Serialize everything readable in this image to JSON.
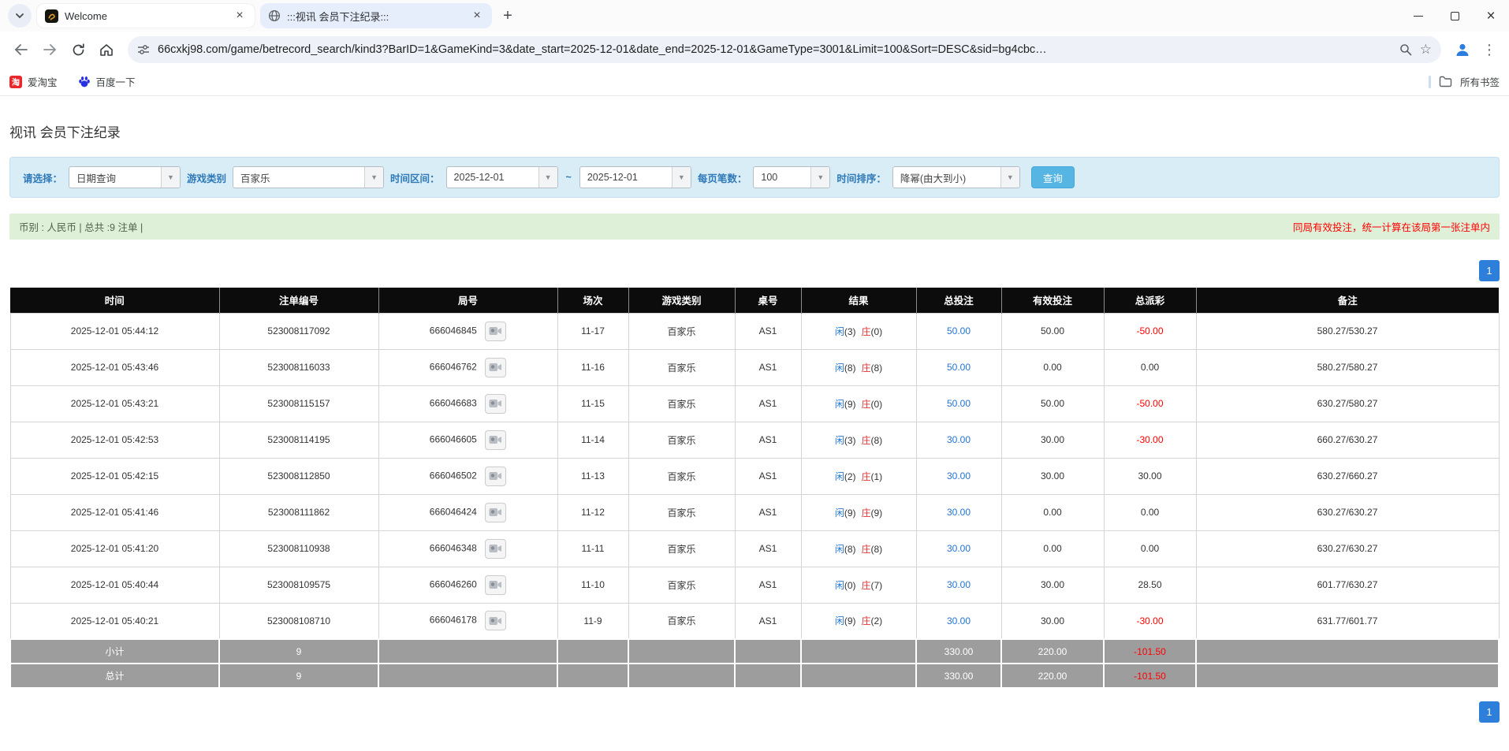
{
  "browser": {
    "tabs": [
      {
        "title": "Welcome"
      },
      {
        "title": ":::视讯 会员下注纪录:::"
      }
    ],
    "url": "66cxkj98.com/game/betrecord_search/kind3?BarID=1&GameKind=3&date_start=2025-12-01&date_end=2025-12-01&GameType=3001&Limit=100&Sort=DESC&sid=bg4cbc…",
    "bookmarks": [
      {
        "label": "爱淘宝"
      },
      {
        "label": "百度一下"
      }
    ],
    "all_bookmarks_label": "所有书签",
    "icons": [
      "chevron-down-icon",
      "dragon-favicon-icon",
      "globe-favicon-icon",
      "close-icon",
      "new-tab-icon",
      "minimize-icon",
      "maximize-icon",
      "back-icon",
      "forward-icon",
      "reload-icon",
      "home-icon",
      "tune-icon",
      "zoom-icon",
      "star-icon",
      "profile-icon",
      "kebab-menu-icon",
      "taobao-icon",
      "baidu-paw-icon",
      "folder-icon",
      "video-replay-icon"
    ]
  },
  "page": {
    "title": "视讯 会员下注纪录",
    "filters": {
      "select_label": "请选择：",
      "select_value": "日期查询",
      "game_type_label": "游戏类别",
      "game_type_value": "百家乐",
      "range_label": "时间区间：",
      "date_start": "2025-12-01",
      "range_separator": "~",
      "date_end": "2025-12-01",
      "page_size_label": "每页笔数：",
      "page_size_value": "100",
      "sort_label": "时间排序：",
      "sort_value": "降幂(由大到小)",
      "search_button": "查询"
    },
    "info_bar": {
      "left": "币别 : 人民币 | 总共 :9 注单 |",
      "right": "同局有效投注，统一计算在该局第一张注单内"
    },
    "pagination": {
      "page": "1"
    },
    "table": {
      "headers": [
        "时间",
        "注单编号",
        "局号",
        "场次",
        "游戏类别",
        "桌号",
        "结果",
        "总投注",
        "有效投注",
        "总派彩",
        "备注"
      ],
      "rows": [
        {
          "time": "2025-12-01 05:44:12",
          "bet_id": "523008117092",
          "round_id": "666046845",
          "session": "11-17",
          "game": "百家乐",
          "table": "AS1",
          "player": "闲",
          "player_num": "(3)",
          "banker": "庄",
          "banker_num": "(0)",
          "total_bet": "50.00",
          "valid_bet": "50.00",
          "payout": "-50.00",
          "remark": "580.27/530.27"
        },
        {
          "time": "2025-12-01 05:43:46",
          "bet_id": "523008116033",
          "round_id": "666046762",
          "session": "11-16",
          "game": "百家乐",
          "table": "AS1",
          "player": "闲",
          "player_num": "(8)",
          "banker": "庄",
          "banker_num": "(8)",
          "total_bet": "50.00",
          "valid_bet": "0.00",
          "payout": "0.00",
          "remark": "580.27/580.27"
        },
        {
          "time": "2025-12-01 05:43:21",
          "bet_id": "523008115157",
          "round_id": "666046683",
          "session": "11-15",
          "game": "百家乐",
          "table": "AS1",
          "player": "闲",
          "player_num": "(9)",
          "banker": "庄",
          "banker_num": "(0)",
          "total_bet": "50.00",
          "valid_bet": "50.00",
          "payout": "-50.00",
          "remark": "630.27/580.27"
        },
        {
          "time": "2025-12-01 05:42:53",
          "bet_id": "523008114195",
          "round_id": "666046605",
          "session": "11-14",
          "game": "百家乐",
          "table": "AS1",
          "player": "闲",
          "player_num": "(3)",
          "banker": "庄",
          "banker_num": "(8)",
          "total_bet": "30.00",
          "valid_bet": "30.00",
          "payout": "-30.00",
          "remark": "660.27/630.27"
        },
        {
          "time": "2025-12-01 05:42:15",
          "bet_id": "523008112850",
          "round_id": "666046502",
          "session": "11-13",
          "game": "百家乐",
          "table": "AS1",
          "player": "闲",
          "player_num": "(2)",
          "banker": "庄",
          "banker_num": "(1)",
          "total_bet": "30.00",
          "valid_bet": "30.00",
          "payout": "30.00",
          "remark": "630.27/660.27"
        },
        {
          "time": "2025-12-01 05:41:46",
          "bet_id": "523008111862",
          "round_id": "666046424",
          "session": "11-12",
          "game": "百家乐",
          "table": "AS1",
          "player": "闲",
          "player_num": "(9)",
          "banker": "庄",
          "banker_num": "(9)",
          "total_bet": "30.00",
          "valid_bet": "0.00",
          "payout": "0.00",
          "remark": "630.27/630.27"
        },
        {
          "time": "2025-12-01 05:41:20",
          "bet_id": "523008110938",
          "round_id": "666046348",
          "session": "11-11",
          "game": "百家乐",
          "table": "AS1",
          "player": "闲",
          "player_num": "(8)",
          "banker": "庄",
          "banker_num": "(8)",
          "total_bet": "30.00",
          "valid_bet": "0.00",
          "payout": "0.00",
          "remark": "630.27/630.27"
        },
        {
          "time": "2025-12-01 05:40:44",
          "bet_id": "523008109575",
          "round_id": "666046260",
          "session": "11-10",
          "game": "百家乐",
          "table": "AS1",
          "player": "闲",
          "player_num": "(0)",
          "banker": "庄",
          "banker_num": "(7)",
          "total_bet": "30.00",
          "valid_bet": "30.00",
          "payout": "28.50",
          "remark": "601.77/630.27"
        },
        {
          "time": "2025-12-01 05:40:21",
          "bet_id": "523008108710",
          "round_id": "666046178",
          "session": "11-9",
          "game": "百家乐",
          "table": "AS1",
          "player": "闲",
          "player_num": "(9)",
          "banker": "庄",
          "banker_num": "(2)",
          "total_bet": "30.00",
          "valid_bet": "30.00",
          "payout": "-30.00",
          "remark": "631.77/601.77"
        }
      ],
      "subtotal": {
        "label": "小计",
        "count": "9",
        "total_bet": "330.00",
        "valid_bet": "220.00",
        "payout": "-101.50"
      },
      "total": {
        "label": "总计",
        "count": "9",
        "total_bet": "330.00",
        "valid_bet": "220.00",
        "payout": "-101.50"
      }
    }
  },
  "colors": {
    "accent_blue": "#2374d4",
    "banker_red": "#e03434",
    "negative_red": "#ff0000",
    "header_bg": "#0c0c0c",
    "footer_bg": "#9d9d9d",
    "filter_bg": "#d9edf7",
    "info_bg": "#dff0d8",
    "pager_blue": "#2e7fd9",
    "active_tab_bg": "#e7eefb",
    "search_btn": "#57b5e3"
  }
}
